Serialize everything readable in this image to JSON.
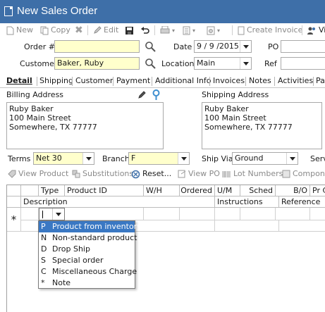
{
  "window": {
    "title": "New Sales Order"
  },
  "toolbar": {
    "new": "New",
    "copy": "Copy",
    "edit": "Edit",
    "create_invoice": "Create Invoice",
    "vi": "Vi"
  },
  "header": {
    "order_label": "Order #",
    "order_value": "",
    "date_label": "Date",
    "date_value": "9 / 9 /2015",
    "po_label": "PO",
    "customer_label": "Customer",
    "customer_value": "Baker, Ruby",
    "location_label": "Location",
    "location_value": "Main",
    "ref_label": "Ref"
  },
  "tabs": [
    "Detail",
    "Shipping",
    "Customer",
    "Payment",
    "Additional Info",
    "Invoices",
    "Notes",
    "Activities",
    "Pa"
  ],
  "billing": {
    "label": "Billing Address",
    "lines": [
      "Ruby Baker",
      "100 Main Street",
      "Somewhere, TX 77777"
    ]
  },
  "shipping": {
    "label": "Shipping Address",
    "lines": [
      "Ruby Baker",
      "100 Main Street",
      "Somewhere, TX 77777"
    ]
  },
  "terms": {
    "terms_label": "Terms",
    "terms_value": "Net 30",
    "branch_label": "Branch",
    "branch_value": "F",
    "shipvia_label": "Ship Via",
    "shipvia_value": "Ground",
    "serv_label": "Serv"
  },
  "line_toolbar": {
    "view_product": "View Product",
    "substitutions": "Substitutions",
    "reset": "Reset...",
    "view_po": "View PO",
    "lot_numbers": "Lot Numbers",
    "components": "Compone"
  },
  "grid": {
    "headers_row1": [
      "Type",
      "Product ID",
      "W/H",
      "Ordered",
      "U/M",
      "Sched",
      "B/O",
      "Pr C"
    ],
    "headers_row2": [
      "Description",
      "Instructions",
      "Reference"
    ],
    "new_row_marker": "*"
  },
  "type_dropdown": {
    "items": [
      {
        "code": "P",
        "label": "Product from inventory",
        "selected": true
      },
      {
        "code": "N",
        "label": "Non-standard product",
        "selected": false
      },
      {
        "code": "D",
        "label": "Drop Ship",
        "selected": false
      },
      {
        "code": "S",
        "label": "Special order",
        "selected": false
      },
      {
        "code": "C",
        "label": "Miscellaneous Charge",
        "selected": false
      },
      {
        "code": "*",
        "label": "Note",
        "selected": false
      }
    ]
  },
  "colors": {
    "title_bar": "#3e6fa8",
    "required_field": "#ffffcc",
    "selection": "#3a78c3"
  }
}
